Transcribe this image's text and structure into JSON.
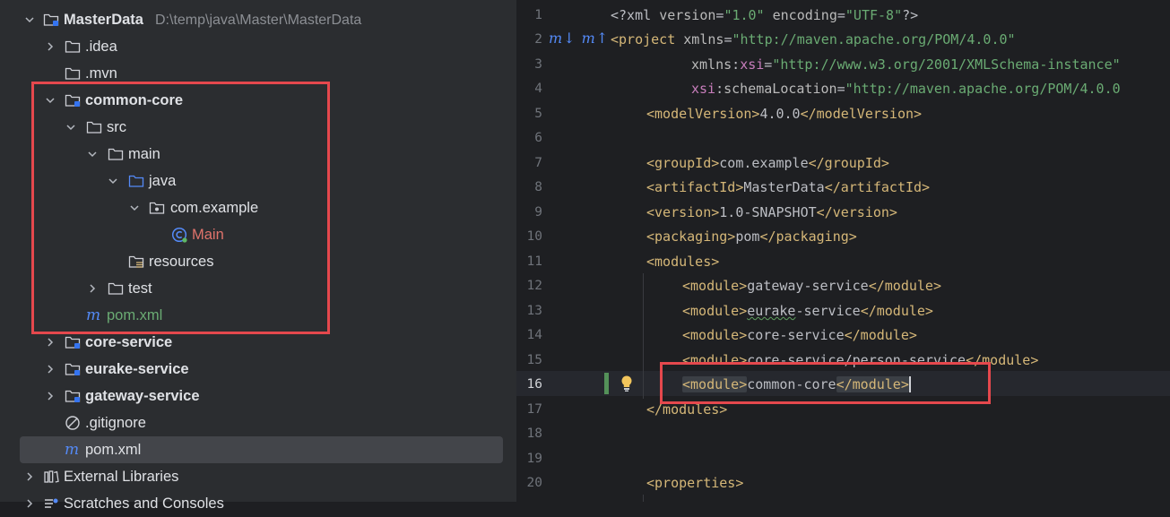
{
  "tree": {
    "rows": [
      {
        "label": "MasterData",
        "path": "D:\\temp\\java\\Master\\MasterData"
      },
      {
        "label": ".idea"
      },
      {
        "label": ".mvn"
      },
      {
        "label": "common-core"
      },
      {
        "label": "src"
      },
      {
        "label": "main"
      },
      {
        "label": "java"
      },
      {
        "label": "com.example"
      },
      {
        "label": "Main"
      },
      {
        "label": "resources"
      },
      {
        "label": "test"
      },
      {
        "label": "pom.xml"
      },
      {
        "label": "core-service"
      },
      {
        "label": "eurake-service"
      },
      {
        "label": "gateway-service"
      },
      {
        "label": ".gitignore"
      },
      {
        "label": "pom.xml"
      },
      {
        "label": "External Libraries"
      },
      {
        "label": "Scratches and Consoles"
      }
    ]
  },
  "editor": {
    "line_numbers": [
      "1",
      "2",
      "3",
      "4",
      "5",
      "6",
      "7",
      "8",
      "9",
      "10",
      "11",
      "12",
      "13",
      "14",
      "15",
      "16",
      "17",
      "18",
      "19",
      "20"
    ],
    "current_line": "16",
    "gutter_maven_icon": "m↓ m↑",
    "lines": {
      "l1": {
        "a": "<?xml ",
        "b": "version",
        "c": "=",
        "d": "\"1.0\"",
        "e": " ",
        "f": "encoding",
        "g": "=",
        "h": "\"UTF-8\"",
        "i": "?>"
      },
      "l2": {
        "a": "<project ",
        "b": "xmlns",
        "c": "=",
        "d": "\"http://maven.apache.org/POM/4.0.0\""
      },
      "l3": {
        "a": "xmlns",
        "b": ":",
        "c": "xsi",
        "d": "=",
        "e": "\"http://www.w3.org/2001/XMLSchema-instance\""
      },
      "l4": {
        "a": "xsi",
        "b": ":",
        "c": "schemaLocation",
        "d": "=",
        "e": "\"http://maven.apache.org/POM/4.0.0"
      },
      "l5": {
        "a": "<modelVersion>",
        "b": "4.0.0",
        "c": "</modelVersion>"
      },
      "l7": {
        "a": "<groupId>",
        "b": "com.example",
        "c": "</groupId>"
      },
      "l8": {
        "a": "<artifactId>",
        "b": "MasterData",
        "c": "</artifactId>"
      },
      "l9": {
        "a": "<version>",
        "b": "1.0-SNAPSHOT",
        "c": "</version>"
      },
      "l10": {
        "a": "<packaging>",
        "b": "pom",
        "c": "</packaging>"
      },
      "l11": {
        "a": "<modules>"
      },
      "l12": {
        "a": "<module>",
        "b": "gateway-service",
        "c": "</module>"
      },
      "l13": {
        "a": "<module>",
        "b": "eurake",
        "c": "-service",
        "d": "</module>"
      },
      "l14": {
        "a": "<module>",
        "b": "core-service",
        "c": "</module>"
      },
      "l15": {
        "a": "<module>",
        "b": "core-service/person-service",
        "c": "</module>"
      },
      "l16": {
        "a": "<module>",
        "b": "common-core",
        "c": "</module>"
      },
      "l17": {
        "a": "</modules>"
      },
      "l20": {
        "a": "<properties>"
      }
    }
  },
  "colors": {
    "highlight_box": "#e5484d",
    "tag": "#d5b778",
    "string": "#6aab73",
    "namespace": "#c77dbb",
    "module_file": "#e0736b"
  }
}
